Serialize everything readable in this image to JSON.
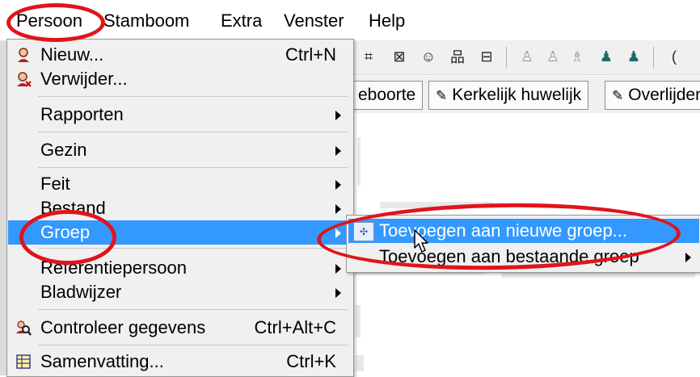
{
  "menubar": {
    "items": [
      "Persoon",
      "Stamboom",
      "Extra",
      "Venster",
      "Help"
    ]
  },
  "menu": {
    "new_label": "Nieuw...",
    "new_shortcut": "Ctrl+N",
    "delete_label": "Verwijder...",
    "reports_label": "Rapporten",
    "family_label": "Gezin",
    "fact_label": "Feit",
    "file_label": "Bestand",
    "group_label": "Groep",
    "ref_person_label": "Referentiepersoon",
    "bookmark_label": "Bladwijzer",
    "check_label": "Controleer gegevens",
    "check_shortcut": "Ctrl+Alt+C",
    "summary_label": "Samenvatting...",
    "summary_shortcut": "Ctrl+K"
  },
  "submenu": {
    "add_new_group": "Toevoegen aan nieuwe groep...",
    "add_existing_group": "Toevoegen aan bestaande groep"
  },
  "tabs": [
    "eboorte",
    "Kerkelijk huwelijk",
    "Overlijden"
  ],
  "icons": {
    "new": "person-add-icon",
    "delete": "person-remove-icon",
    "check": "magnify-person-icon",
    "summary": "summary-table-icon",
    "group": "group-dots-icon"
  },
  "colors": {
    "highlight": "#3399ff",
    "annotation": "#e0141b",
    "menu_bg": "#f0f0f0"
  }
}
